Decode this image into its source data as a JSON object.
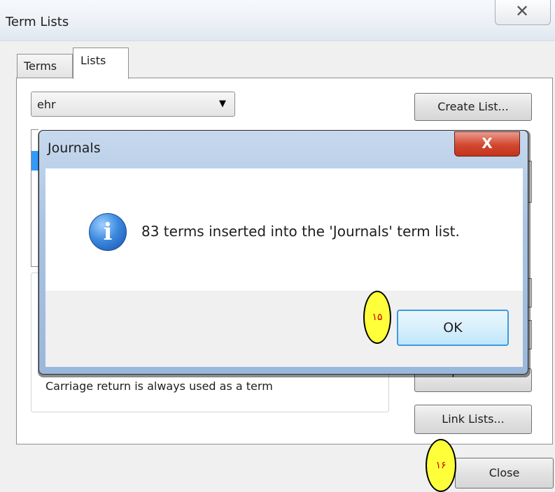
{
  "window": {
    "title": "Term Lists",
    "close_glyph": "✕"
  },
  "tabs": [
    {
      "label": "Terms"
    },
    {
      "label": "Lists"
    }
  ],
  "list_selector": {
    "value": "ehr",
    "arrow": "▼"
  },
  "buttons": {
    "create_list": "Create List...",
    "export_list": "Export List...",
    "link_lists": "Link Lists...",
    "close": "Close"
  },
  "groupbox_caption": "Carriage return is always used as a term",
  "dialog": {
    "title": "Journals",
    "close_glyph": "X",
    "icon_glyph": "i",
    "message": "83 terms inserted into the 'Journals' term list.",
    "ok_label": "OK"
  },
  "annotations": {
    "step_15": "۱۵",
    "step_16": "۱۶"
  },
  "colors": {
    "ok_border": "#3c9ade",
    "close_red": "#d1472f",
    "marker_yellow": "#ffff3a",
    "selection_blue": "#3399ff"
  },
  "icons": {
    "dialog_icon": "information-icon",
    "combo_arrow": "chevron-down-icon"
  }
}
